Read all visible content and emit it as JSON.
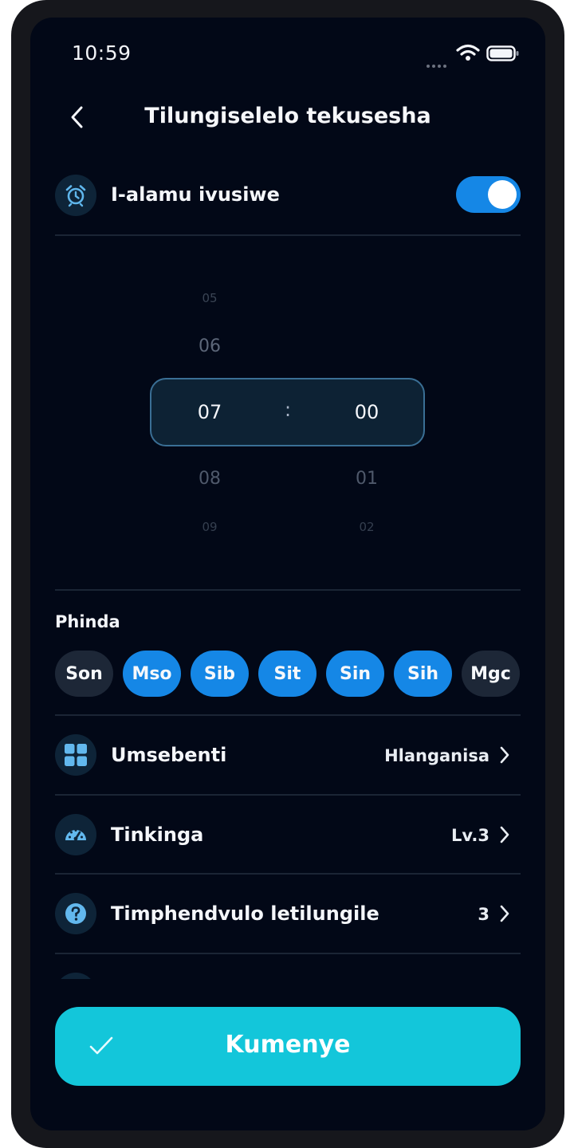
{
  "status_bar": {
    "time": "10:59"
  },
  "header": {
    "title": "Tilungiselelo tekusesha"
  },
  "alarm_toggle": {
    "label": "I-alamu ivusiwe",
    "on": true
  },
  "time_picker": {
    "hours_above": [
      "05",
      "06"
    ],
    "selected_hour": "07",
    "separator": ":",
    "selected_minute": "00",
    "hours_below": [
      "08",
      "09"
    ],
    "minutes_below": [
      "01",
      "02"
    ]
  },
  "repeat": {
    "label": "Phinda",
    "days": [
      {
        "label": "Son",
        "selected": false
      },
      {
        "label": "Mso",
        "selected": true
      },
      {
        "label": "Sib",
        "selected": true
      },
      {
        "label": "Sit",
        "selected": true
      },
      {
        "label": "Sin",
        "selected": true
      },
      {
        "label": "Sih",
        "selected": true
      },
      {
        "label": "Mgc",
        "selected": false
      }
    ]
  },
  "settings": [
    {
      "label": "Umsebenti",
      "value": "Hlanganisa",
      "icon": "grid-icon"
    },
    {
      "label": "Tinkinga",
      "value": "Lv.3",
      "icon": "speedometer-icon"
    },
    {
      "label": "Timphendvulo letilungile",
      "value": "3",
      "icon": "question-icon"
    }
  ],
  "primary_button": {
    "label": "Kumenye"
  },
  "colors": {
    "accent": "#1587e6",
    "cta": "#13c6da",
    "background": "#020817"
  }
}
